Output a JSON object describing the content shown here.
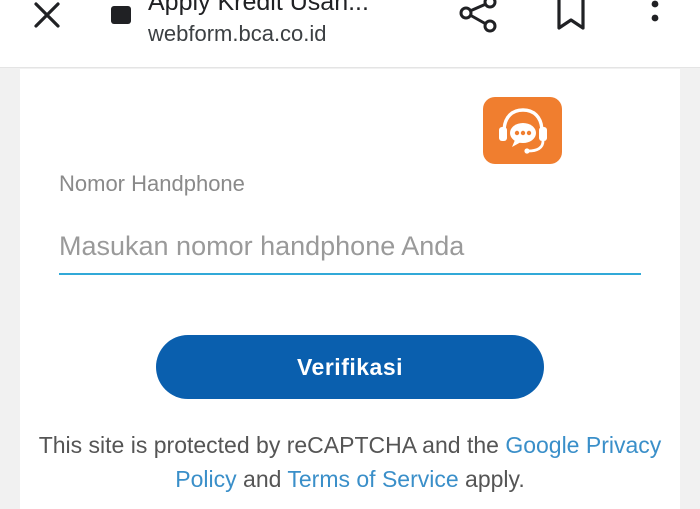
{
  "browser": {
    "title": "Apply Kredit Usah...",
    "url": "webform.bca.co.id",
    "icons": {
      "close": "close-icon",
      "lock": "lock-icon",
      "share": "share-icon",
      "bookmark": "bookmark-icon",
      "more": "more-vert-icon"
    }
  },
  "form": {
    "chat_icon": "chat-support-icon",
    "phone_label": "Nomor Handphone",
    "phone_placeholder": "Masukan nomor handphone Anda",
    "phone_value": "",
    "verify_label": "Verifikasi"
  },
  "recaptcha": {
    "text_before": "This site is protected by reCAPTCHA and the ",
    "privacy_link": "Google Privacy Policy",
    "text_middle": " and ",
    "terms_link": "Terms of Service",
    "text_after": " apply."
  },
  "colors": {
    "accent_blue": "#0a5fae",
    "link_blue": "#3a8fc9",
    "input_underline": "#31a9d8",
    "chat_orange": "#f07e2f"
  }
}
